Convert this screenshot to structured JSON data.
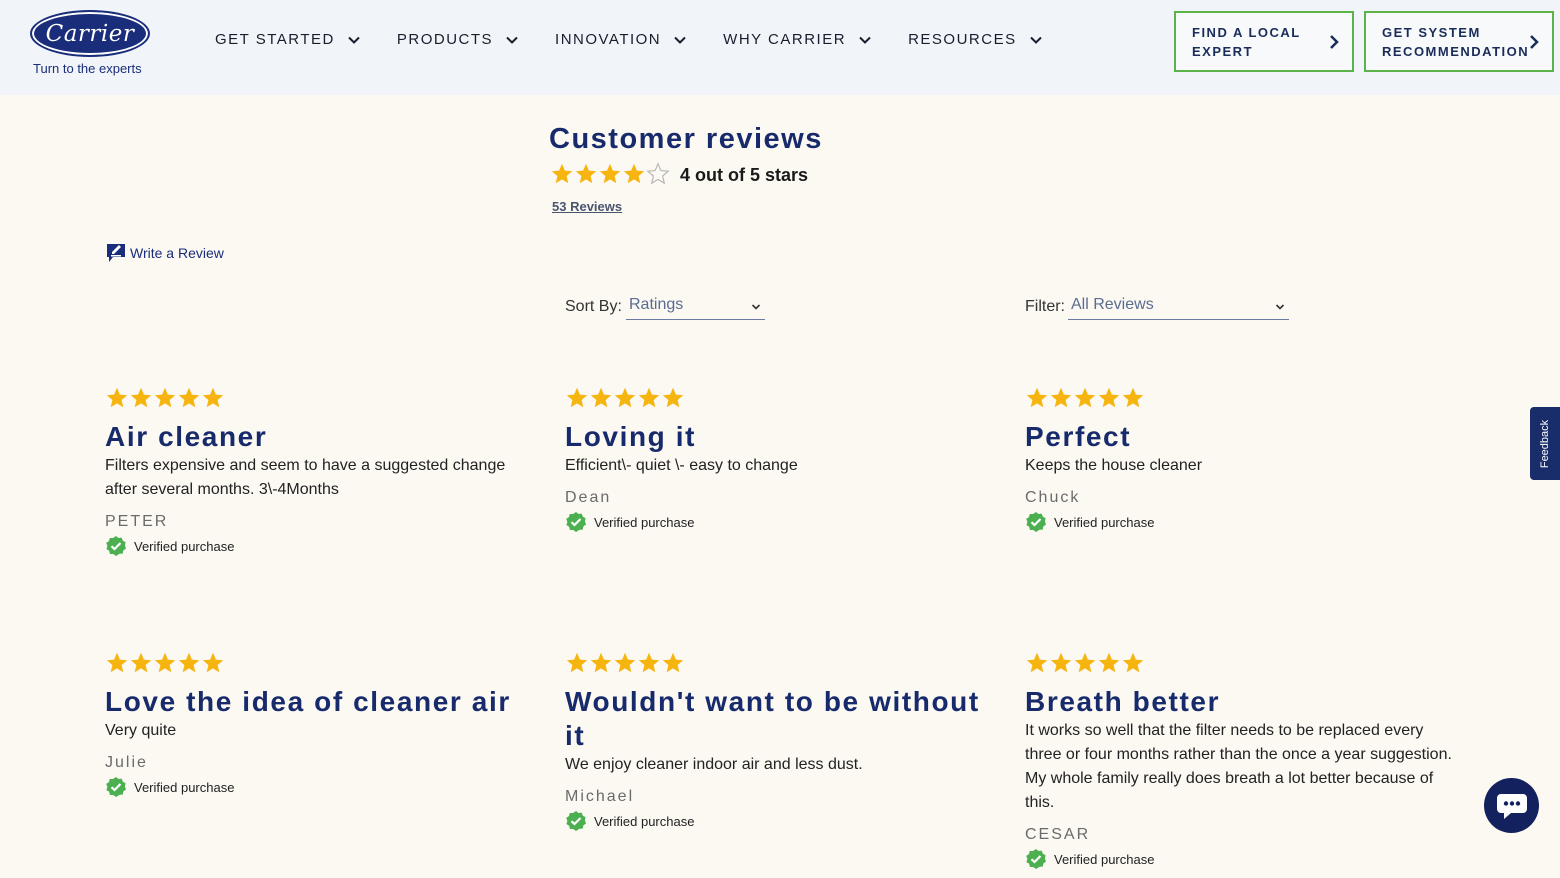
{
  "header": {
    "logo_word": "Carrier",
    "logo_tagline": "Turn to the experts",
    "nav": [
      {
        "label": "GET STARTED"
      },
      {
        "label": "PRODUCTS"
      },
      {
        "label": "INNOVATION"
      },
      {
        "label": "WHY CARRIER"
      },
      {
        "label": "RESOURCES"
      }
    ],
    "cta_find_line1": "FIND A LOCAL",
    "cta_find_line2": "EXPERT",
    "cta_system_line1": "GET SYSTEM",
    "cta_system_line2": "RECOMMENDATION"
  },
  "summary": {
    "title": "Customer reviews",
    "rating": 4,
    "rating_max": 5,
    "rating_text": "4 out of 5 stars",
    "reviews_link": "53 Reviews"
  },
  "write_review": "Write a Review",
  "controls": {
    "sort_label": "Sort By:",
    "sort_value": "Ratings",
    "filter_label": "Filter:",
    "filter_value": "All Reviews"
  },
  "reviews": [
    {
      "stars": 5,
      "title": "Air cleaner",
      "body": "Filters expensive and seem to have a suggested change after several months. 3\\-4Months",
      "author": "PETER",
      "verified": "Verified purchase"
    },
    {
      "stars": 5,
      "title": "Loving it",
      "body": "Efficient\\- quiet \\- easy to change",
      "author": "Dean",
      "verified": "Verified purchase"
    },
    {
      "stars": 5,
      "title": "Perfect",
      "body": "Keeps the house cleaner",
      "author": "Chuck",
      "verified": "Verified purchase"
    },
    {
      "stars": 5,
      "title": "Love the idea of cleaner air",
      "body": "Very quite",
      "author": "Julie",
      "verified": "Verified purchase"
    },
    {
      "stars": 5,
      "title": "Wouldn't want to be without it",
      "body": "We enjoy cleaner indoor air and less dust.",
      "author": "Michael",
      "verified": "Verified purchase"
    },
    {
      "stars": 5,
      "title": "Breath better",
      "body": "It works so well that the filter needs to be replaced every three or four months rather than the once a year suggestion. My whole family really does breath a lot better because of this.",
      "author": "CESAR",
      "verified": "Verified purchase"
    }
  ],
  "feedback_tab": "Feedback",
  "colors": {
    "brand_navy": "#172a6b",
    "star_gold": "#f6b40e",
    "cta_border": "#5cb34a",
    "verified_green": "#4caf50"
  }
}
